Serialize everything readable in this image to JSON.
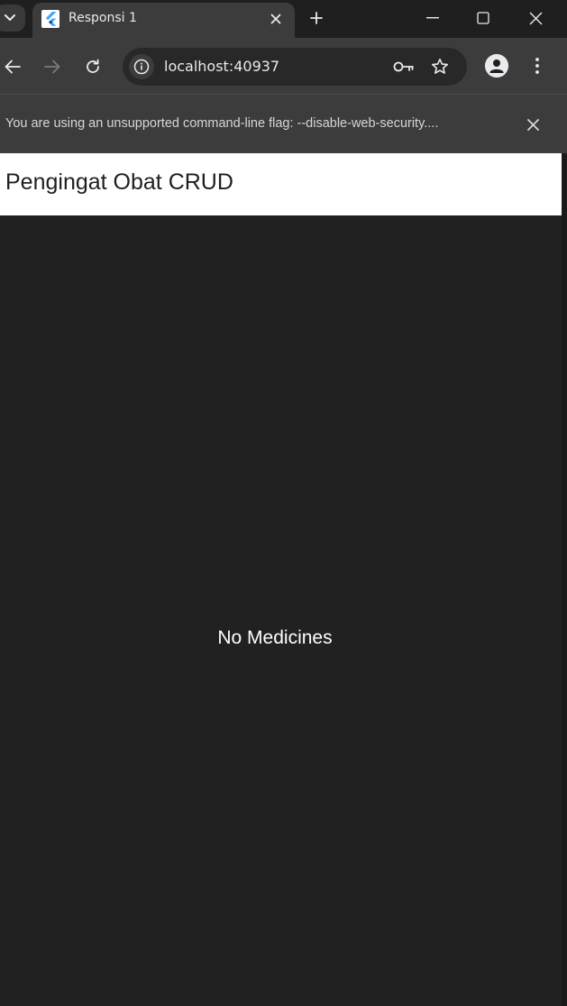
{
  "browser": {
    "tab": {
      "title": "Responsi 1",
      "favicon": "flutter-logo-icon"
    },
    "address_bar": {
      "url": "localhost:40937"
    },
    "icons": {
      "tab_search": "chevron-down-icon",
      "tab_close": "close-icon",
      "new_tab": "plus-icon",
      "minimize": "minimize-icon",
      "maximize": "maximize-icon",
      "window_close": "close-icon",
      "back": "back-arrow-icon",
      "forward": "forward-arrow-icon",
      "reload": "reload-icon",
      "site_info": "info-icon",
      "password_key": "key-icon",
      "bookmark": "star-icon",
      "profile": "profile-avatar-icon",
      "menu": "kebab-menu-icon"
    },
    "infobar": {
      "message": "You are using an unsupported command-line flag: --disable-web-security...."
    }
  },
  "app": {
    "appbar_title": "Pengingat Obat CRUD",
    "empty_state": "No Medicines"
  },
  "colors": {
    "chrome_dark": "#3c3c3c",
    "tabstrip": "#1f1f1f",
    "page_background": "#212121",
    "appbar_background": "#ffffff",
    "text_light": "#e8eaed"
  }
}
